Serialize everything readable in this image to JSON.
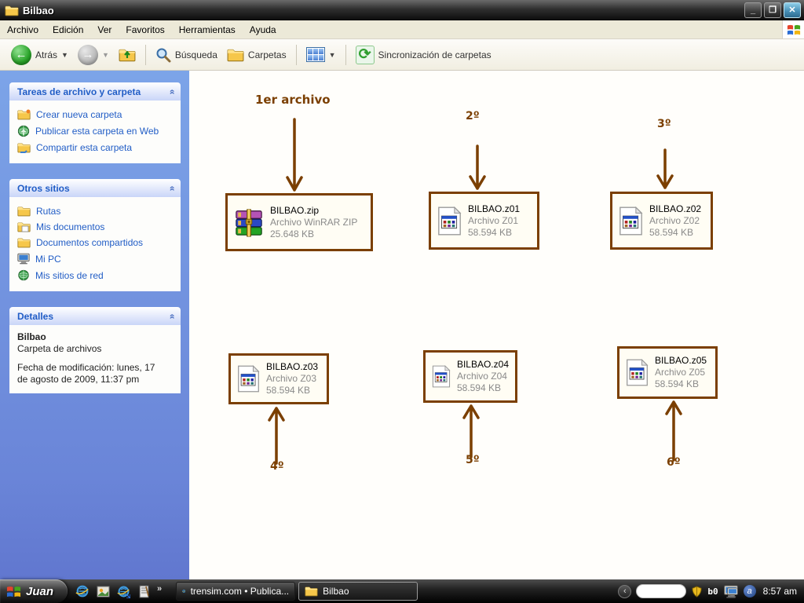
{
  "window": {
    "title": "Bilbao"
  },
  "menubar": {
    "items": [
      "Archivo",
      "Edición",
      "Ver",
      "Favoritos",
      "Herramientas",
      "Ayuda"
    ]
  },
  "toolbar": {
    "back_label": "Atrás",
    "search_label": "Búsqueda",
    "folders_label": "Carpetas",
    "sync_label": "Sincronización de carpetas"
  },
  "sidebar": {
    "file_tasks": {
      "title": "Tareas de archivo y carpeta",
      "items": [
        "Crear nueva carpeta",
        "Publicar esta carpeta en Web",
        "Compartir esta carpeta"
      ]
    },
    "other_places": {
      "title": "Otros sitios",
      "items": [
        "Rutas",
        "Mis documentos",
        "Documentos compartidos",
        "Mi PC",
        "Mis sitios de red"
      ]
    },
    "details": {
      "title": "Detalles",
      "name": "Bilbao",
      "type": "Carpeta de archivos",
      "modified": "Fecha de modificación: lunes, 17 de agosto de 2009, 11:37 pm"
    }
  },
  "files": [
    {
      "name": "BILBAO.zip",
      "type": "Archivo WinRAR ZIP",
      "size": "25.648 KB",
      "icon": "winrar-archive-icon"
    },
    {
      "name": "BILBAO.z01",
      "type": "Archivo Z01",
      "size": "58.594 KB",
      "icon": "generic-file-icon"
    },
    {
      "name": "BILBAO.z02",
      "type": "Archivo Z02",
      "size": "58.594 KB",
      "icon": "generic-file-icon"
    },
    {
      "name": "BILBAO.z03",
      "type": "Archivo Z03",
      "size": "58.594 KB",
      "icon": "generic-file-icon"
    },
    {
      "name": "BILBAO.z04",
      "type": "Archivo Z04",
      "size": "58.594 KB",
      "icon": "generic-file-icon"
    },
    {
      "name": "BILBAO.z05",
      "type": "Archivo Z05",
      "size": "58.594 KB",
      "icon": "generic-file-icon"
    }
  ],
  "annotations": {
    "color": "#7b3f00",
    "labels": [
      "1er archivo",
      "2º",
      "3º",
      "4º",
      "5º",
      "6º"
    ]
  },
  "taskbar": {
    "start_label": "Juan",
    "tasks": [
      {
        "label": "trensim.com • Publica...",
        "icon": "ie-icon"
      },
      {
        "label": "Bilbao",
        "icon": "folder-icon"
      }
    ],
    "tray": {
      "meter_text": "b0",
      "clock": "8:57 am"
    }
  },
  "icons": {
    "titlebar": "folder-icon",
    "toolbar": [
      "back-icon",
      "forward-icon",
      "up-folder-icon",
      "search-icon",
      "folders-icon",
      "views-grid-icon",
      "sync-icon"
    ],
    "menubar_corner": "windows-logo-icon",
    "tray": [
      "hidden-icons-chevron",
      "language-pill",
      "shield-icon",
      "network-icon",
      "app-a-icon"
    ]
  },
  "colors": {
    "annotation": "#7b3f00",
    "sidebar_link": "#215dc6",
    "close_button": "#4a92b8"
  }
}
